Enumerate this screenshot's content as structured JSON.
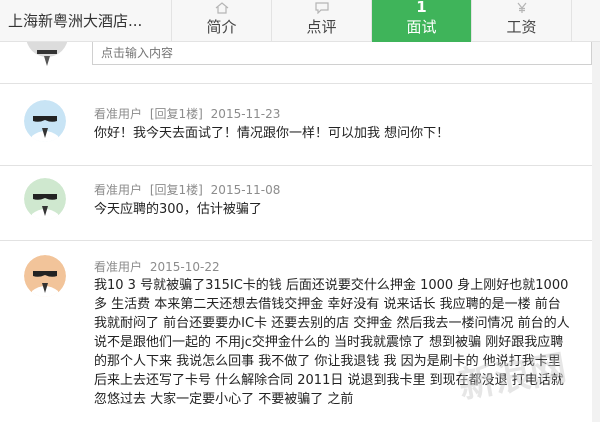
{
  "header": {
    "company_name": "上海新粤洲大酒店...",
    "tabs": [
      {
        "label": "简介",
        "icon": "home-icon"
      },
      {
        "label": "点评",
        "icon": "comment-icon"
      },
      {
        "label": "面试",
        "count": "1"
      },
      {
        "label": "工资",
        "icon": "yen-icon"
      }
    ],
    "active_color": "#3fb45a"
  },
  "reply_input": {
    "placeholder": "点击输入内容"
  },
  "comments": [
    {
      "user": "看准用户",
      "reply_tag": "[回复1楼]",
      "date": "2015-11-23",
      "text": "你好！我今天去面试了！情况跟你一样！可以加我 想问你下！",
      "avatar_color": "#c8e4f5"
    },
    {
      "user": "看准用户",
      "reply_tag": "[回复1楼]",
      "date": "2015-11-08",
      "text": "今天应聘的300，估计被骗了",
      "avatar_color": "#cfe8cf"
    },
    {
      "user": "看准用户",
      "reply_tag": "",
      "date": "2015-10-22",
      "text": "我10 3 号就被骗了315IC卡的钱 后面还说要交什么押金 1000 身上刚好也就1000多 生活费 本来第二天还想去借钱交押金 幸好没有 说来话长 我应聘的是一楼 前台 我就耐闷了 前台还要要办IC卡 还要去别的店 交押金 然后我去一楼问情况 前台的人说不是跟他们一起的 不用jc交押金什么的 当时我就震惊了 想到被骗 刚好跟我应聘的那个人下来 我说怎么回事 我不做了 你让我退钱 我 因为是刷卡的 他说打我卡里 后来上去还写了卡号 什么解除合同 2011日 说退到我卡里 到现在都没退 打电话就忽悠过去 大家一定要小心了 不要被骗了 之前",
      "avatar_color": "#f2c49a"
    }
  ],
  "watermark": "新浪网"
}
